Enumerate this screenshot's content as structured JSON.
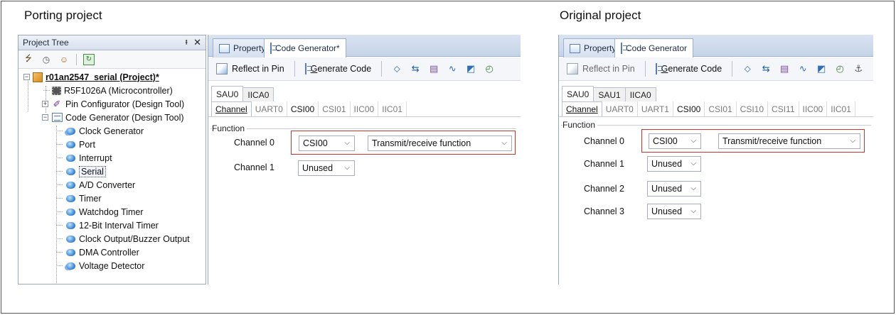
{
  "captions": {
    "left": "Porting project",
    "right": "Original project"
  },
  "project_tree": {
    "title": "Project Tree",
    "pin_glyph": "Դ",
    "close_glyph": "✕",
    "items": [
      {
        "label": "r01an2547_serial (Project)*",
        "icon": "project-icon"
      },
      {
        "label": "R5F1026A (Microcontroller)",
        "icon": "chip-icon"
      },
      {
        "label": "Pin Configurator (Design Tool)",
        "icon": "pin-tool-icon"
      },
      {
        "label": "Code Generator (Design Tool)",
        "icon": "code-gen-icon"
      },
      {
        "label": "Clock Generator",
        "icon": "gear-icon"
      },
      {
        "label": "Port",
        "icon": "gear-icon"
      },
      {
        "label": "Interrupt",
        "icon": "gear-icon"
      },
      {
        "label": "Serial",
        "icon": "gear-icon"
      },
      {
        "label": "A/D Converter",
        "icon": "gear-icon"
      },
      {
        "label": "Timer",
        "icon": "gear-icon"
      },
      {
        "label": "Watchdog Timer",
        "icon": "gear-icon"
      },
      {
        "label": "12-Bit Interval Timer",
        "icon": "gear-icon"
      },
      {
        "label": "Clock Output/Buzzer Output",
        "icon": "gear-icon"
      },
      {
        "label": "DMA Controller",
        "icon": "gear-icon"
      },
      {
        "label": "Voltage Detector",
        "icon": "gear-icon"
      }
    ]
  },
  "left_panel": {
    "tab_property": "Property",
    "tab_codegen": "Code Generator*",
    "reflect_label": "Reflect in Pin",
    "generate_label_pre": "",
    "generate_label_u": "G",
    "generate_label_post": "enerate Code",
    "unit_tabs": [
      "SAU0",
      "IICA0"
    ],
    "channel_tabs": [
      "Channel",
      "UART0",
      "CSI00",
      "CSI01",
      "IIC00",
      "IIC01"
    ],
    "function_legend": "Function",
    "channels": [
      {
        "label": "Channel 0",
        "value": "CSI00",
        "func": "Transmit/receive function"
      },
      {
        "label": "Channel 1",
        "value": "Unused"
      }
    ]
  },
  "right_panel": {
    "tab_property": "Property",
    "tab_codegen": "Code Generator",
    "reflect_label": "Reflect in Pin",
    "generate_label_u": "G",
    "generate_label_post": "enerate Code",
    "unit_tabs": [
      "SAU0",
      "SAU1",
      "IICA0"
    ],
    "channel_tabs": [
      "Channel",
      "UART0",
      "UART1",
      "CSI00",
      "CSI01",
      "CSI10",
      "CSI11",
      "IIC00",
      "IIC01"
    ],
    "function_legend": "Function",
    "channels": [
      {
        "label": "Channel 0",
        "value": "CSI00",
        "func": "Transmit/receive function"
      },
      {
        "label": "Channel 1",
        "value": "Unused"
      },
      {
        "label": "Channel 2",
        "value": "Unused"
      },
      {
        "label": "Channel 3",
        "value": "Unused"
      }
    ]
  },
  "colors": {
    "highlight": "#c0392b",
    "tab_bg": "#c6d3e8"
  }
}
